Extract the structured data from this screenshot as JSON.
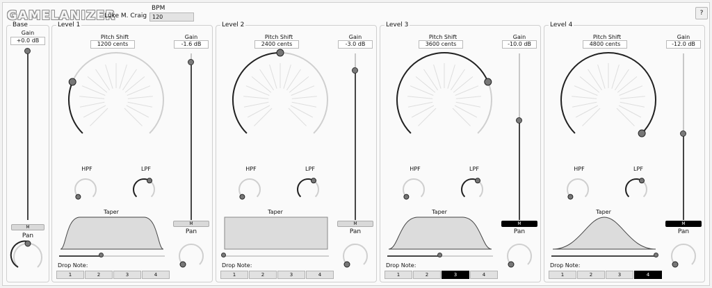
{
  "header": {
    "logo": "GAMELANIZER",
    "author": "Luke M. Craig",
    "bpm_label": "BPM",
    "bpm_value": "120",
    "help_label": "?"
  },
  "base": {
    "title": "Base",
    "gain_label": "Gain",
    "gain_value": "+0.0 dB",
    "mute_label": "M",
    "pan_label": "Pan"
  },
  "levels": [
    {
      "title": "Level 1",
      "pitch_label": "Pitch Shift",
      "pitch_value": "1200 cents",
      "pitch_fraction": 0.25,
      "gain_label": "Gain",
      "gain_value": "-1.6 dB",
      "gain_fraction": 0.95,
      "mute_label": "M",
      "mute_active": false,
      "pan_label": "Pan",
      "hpf_label": "HPF",
      "lpf_label": "LPF",
      "taper_label": "Taper",
      "taper_shape": "trapezoid",
      "taper_slider_fraction": 0.4,
      "drop_label": "Drop Note:",
      "drop_buttons": [
        "1",
        "2",
        "3",
        "4"
      ],
      "drop_active": -1
    },
    {
      "title": "Level 2",
      "pitch_label": "Pitch Shift",
      "pitch_value": "2400 cents",
      "pitch_fraction": 0.5,
      "gain_label": "Gain",
      "gain_value": "-3.0 dB",
      "gain_fraction": 0.9,
      "mute_label": "M",
      "mute_active": false,
      "pan_label": "Pan",
      "hpf_label": "HPF",
      "lpf_label": "LPF",
      "taper_label": "Taper",
      "taper_shape": "rectangle",
      "taper_slider_fraction": 0.0,
      "drop_label": "Drop Note:",
      "drop_buttons": [
        "1",
        "2",
        "3",
        "4"
      ],
      "drop_active": -1
    },
    {
      "title": "Level 3",
      "pitch_label": "Pitch Shift",
      "pitch_value": "3600 cents",
      "pitch_fraction": 0.75,
      "gain_label": "Gain",
      "gain_value": "-10.0 dB",
      "gain_fraction": 0.6,
      "mute_label": "M",
      "mute_active": true,
      "pan_label": "Pan",
      "hpf_label": "HPF",
      "lpf_label": "LPF",
      "taper_label": "Taper",
      "taper_shape": "trapezoid-wide",
      "taper_slider_fraction": 0.5,
      "drop_label": "Drop Note:",
      "drop_buttons": [
        "1",
        "2",
        "3",
        "4"
      ],
      "drop_active": 2
    },
    {
      "title": "Level 4",
      "pitch_label": "Pitch Shift",
      "pitch_value": "4800 cents",
      "pitch_fraction": 1.0,
      "gain_label": "Gain",
      "gain_value": "-12.0 dB",
      "gain_fraction": 0.52,
      "mute_label": "M",
      "mute_active": true,
      "pan_label": "Pan",
      "hpf_label": "HPF",
      "lpf_label": "LPF",
      "taper_label": "Taper",
      "taper_shape": "bell",
      "taper_slider_fraction": 1.0,
      "drop_label": "Drop Note:",
      "drop_buttons": [
        "1",
        "2",
        "3",
        "4"
      ],
      "drop_active": 3
    }
  ]
}
